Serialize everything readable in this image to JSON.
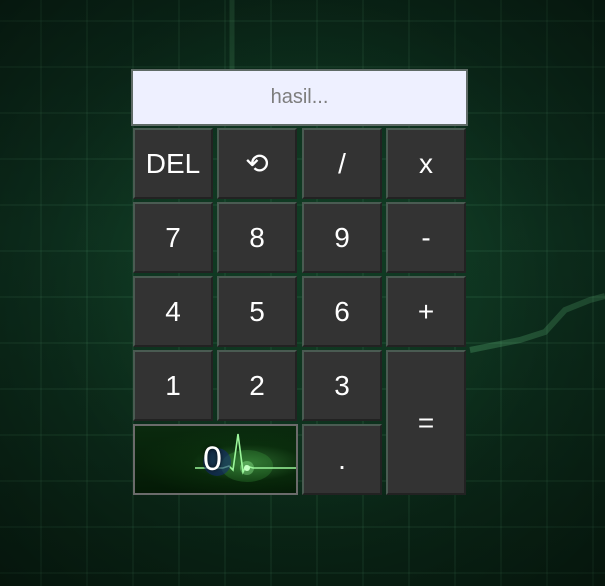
{
  "display": {
    "placeholder": "hasil...",
    "value": ""
  },
  "keys": {
    "del": "DEL",
    "reset": "⟲",
    "divide": "/",
    "multiply": "x",
    "seven": "7",
    "eight": "8",
    "nine": "9",
    "minus": "-",
    "four": "4",
    "five": "5",
    "six": "6",
    "plus": "+",
    "one": "1",
    "two": "2",
    "three": "3",
    "equals": "=",
    "zero": "0",
    "decimal": "."
  },
  "icons": {
    "reset_key": "reset-icon",
    "zero_key_background": "ecg-heartbeat-icon",
    "page_background": "monitor-grid-background"
  },
  "colors": {
    "key_background": "#333333",
    "key_text": "#ffffff",
    "display_background": "#eef0ff",
    "page_background": "#0e3320",
    "ecg_glow": "#7cf07c"
  }
}
